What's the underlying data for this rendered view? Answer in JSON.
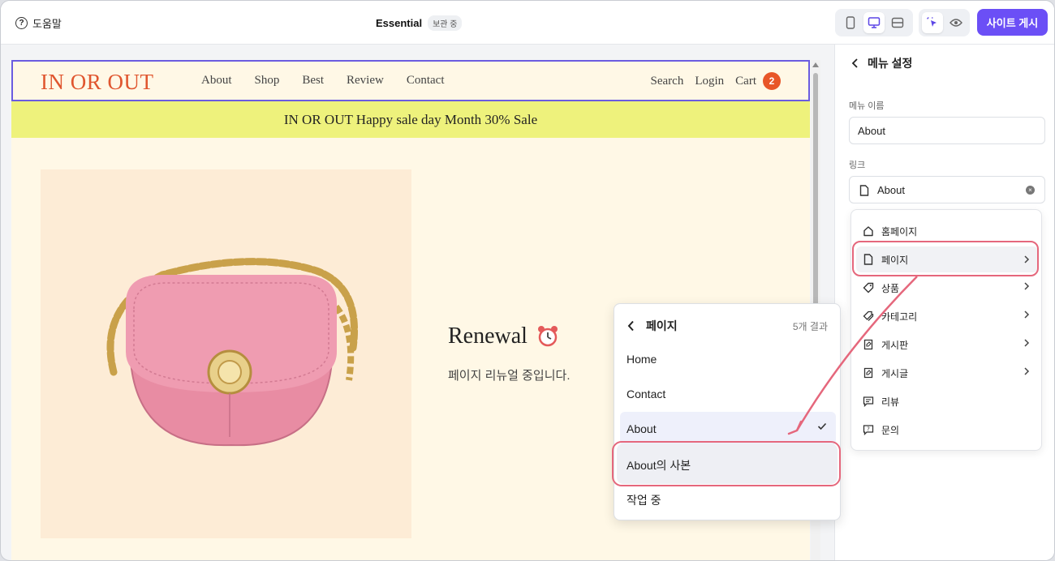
{
  "topbar": {
    "help_label": "도움말",
    "site_title": "Essential",
    "saved_badge": "보관 중",
    "publish_label": "사이트 게시"
  },
  "site": {
    "logo": "IN OR OUT",
    "nav": [
      "About",
      "Shop",
      "Best",
      "Review",
      "Contact"
    ],
    "search": "Search",
    "login": "Login",
    "cart": "Cart",
    "cart_count": "2",
    "sale_banner": "IN OR OUT Happy sale day Month 30% Sale",
    "renewal_title": "Renewal",
    "renewal_sub": "페이지 리뉴얼 중입니다."
  },
  "panel": {
    "title": "메뉴 설정",
    "name_label": "메뉴 이름",
    "name_value": "About",
    "link_label": "링크",
    "link_value": "About"
  },
  "link_menu": [
    {
      "label": "홈페이지",
      "icon": "home-icon",
      "chevron": false
    },
    {
      "label": "페이지",
      "icon": "page-icon",
      "chevron": true
    },
    {
      "label": "상품",
      "icon": "tag-icon",
      "chevron": true
    },
    {
      "label": "카테고리",
      "icon": "tags-icon",
      "chevron": true
    },
    {
      "label": "게시판",
      "icon": "board-icon",
      "chevron": true
    },
    {
      "label": "게시글",
      "icon": "post-icon",
      "chevron": true
    },
    {
      "label": "리뷰",
      "icon": "review-icon",
      "chevron": false
    },
    {
      "label": "문의",
      "icon": "inquiry-icon",
      "chevron": false
    }
  ],
  "page_menu": {
    "title": "페이지",
    "count": "5개 결과",
    "items": [
      "Home",
      "Contact",
      "About",
      "About의 사본",
      "작업 중"
    ],
    "selected": "About"
  },
  "colors": {
    "accent": "#6b4ff6",
    "logo": "#e0562f",
    "highlight": "#e5677c",
    "sale_bar": "#eef27c"
  }
}
